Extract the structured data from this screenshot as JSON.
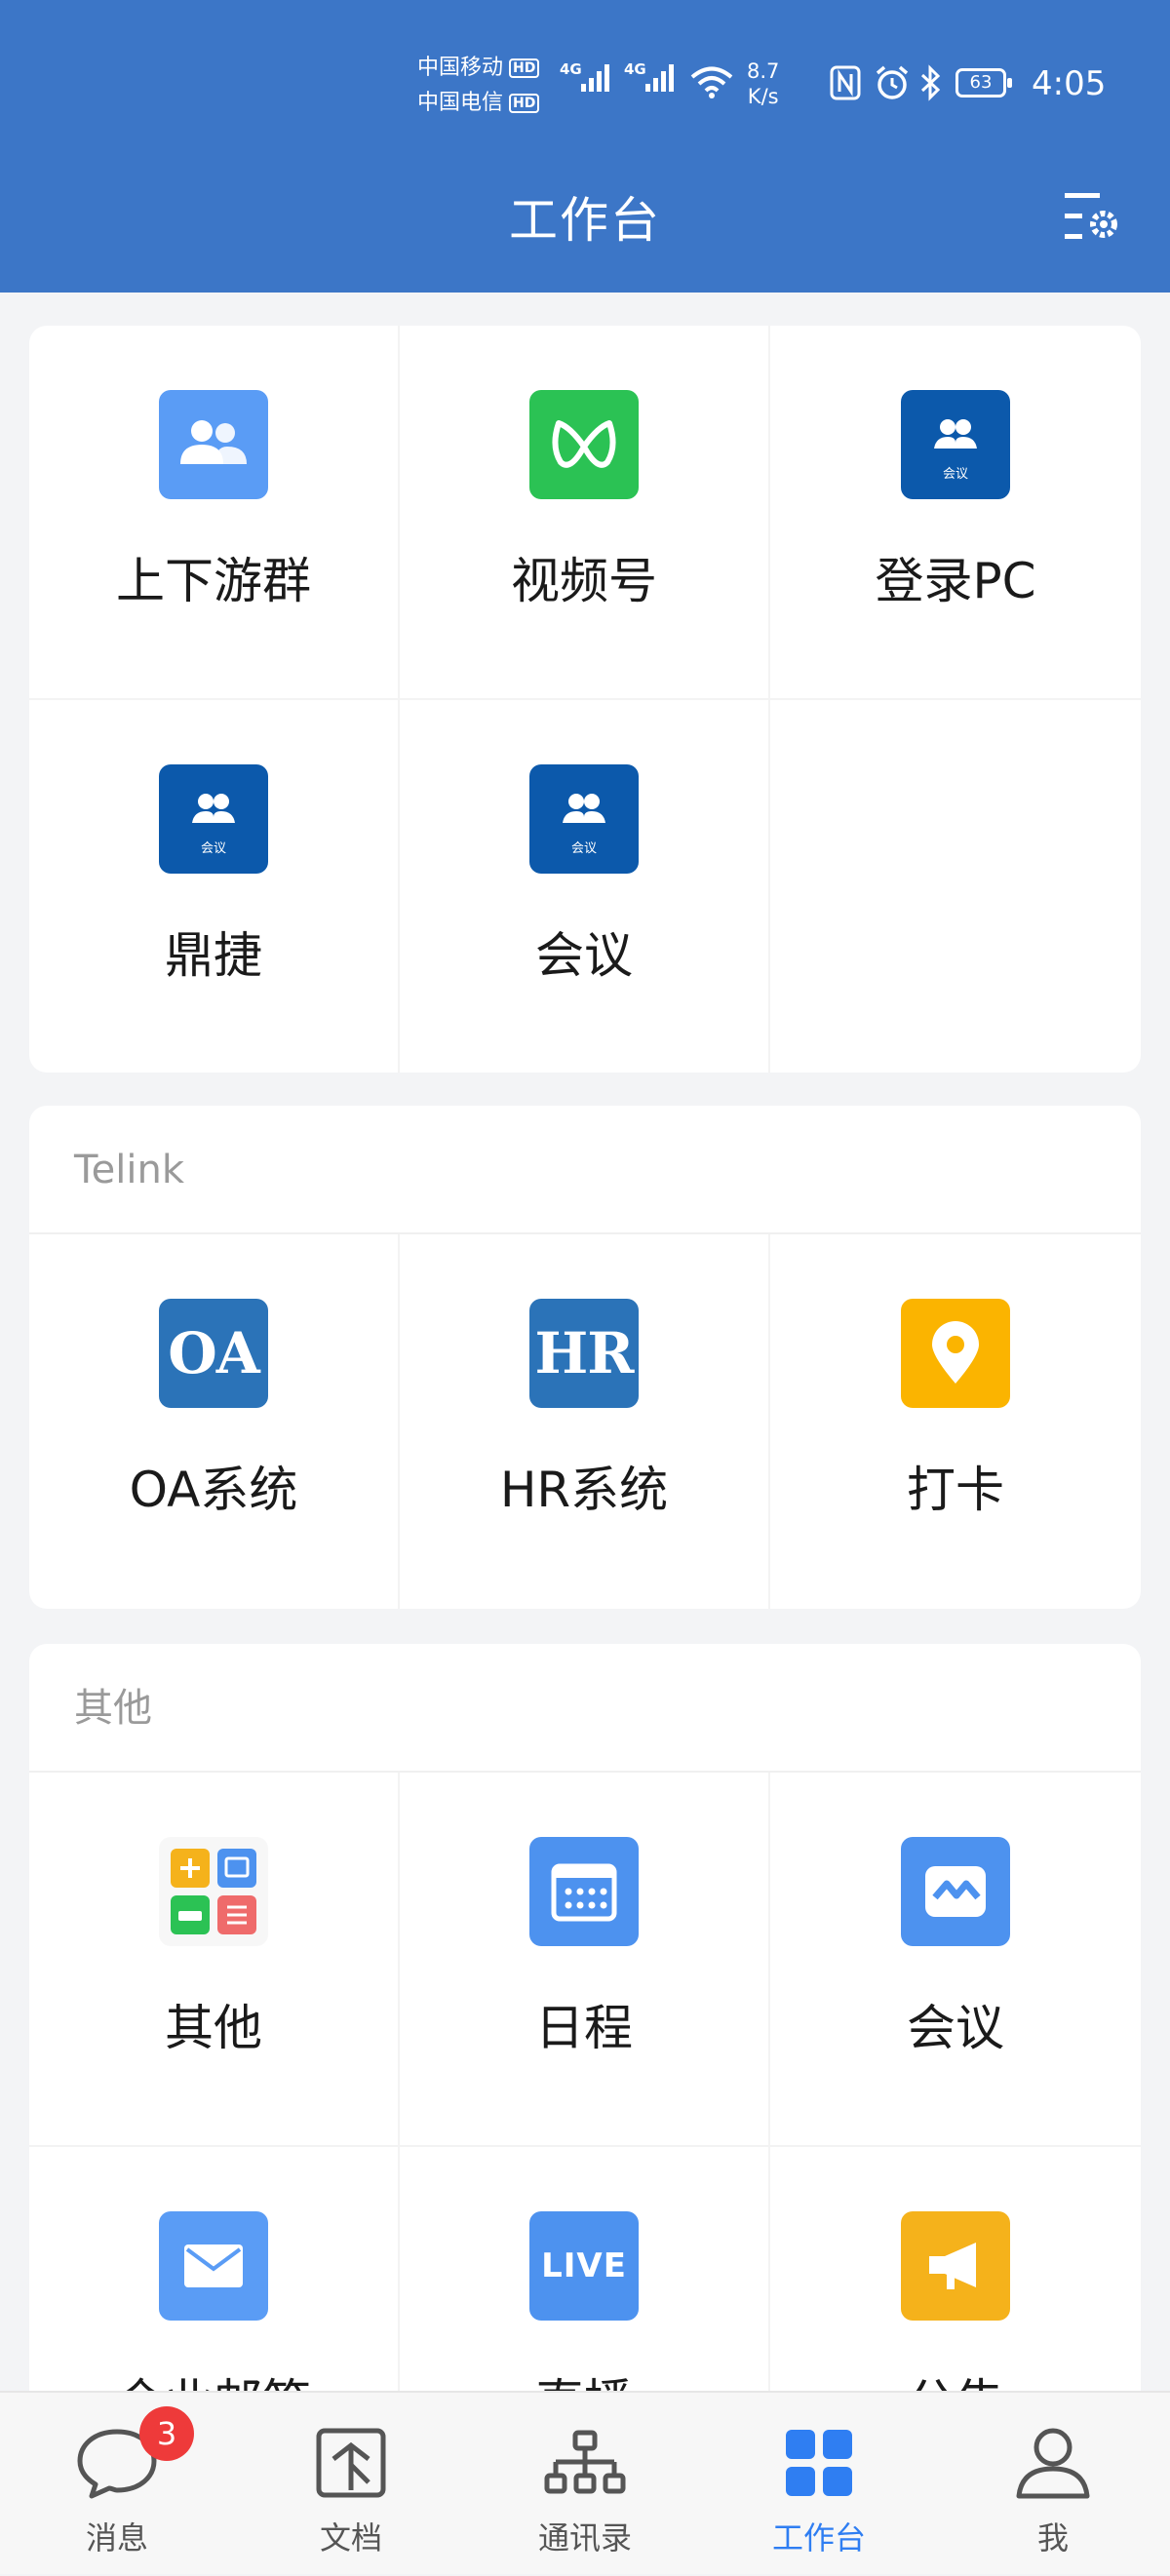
{
  "status_bar": {
    "carrier1": "中国移动",
    "carrier2": "中国电信",
    "hd": "HD",
    "net1": "4G",
    "net2": "4G",
    "speed_value": "8.7",
    "speed_unit": "K/s",
    "battery": "63",
    "time": "4:05",
    "icons": [
      "nfc-icon",
      "alarm-icon",
      "bluetooth-icon",
      "wifi-icon"
    ]
  },
  "header": {
    "title": "工作台",
    "settings_icon": "list-settings-icon"
  },
  "colors": {
    "header_bg": "#3c76c7",
    "accent": "#2f7ef2",
    "badge": "#ee3a3a"
  },
  "section1": {
    "apps": [
      {
        "label": "上下游群",
        "icon": "group-people-icon",
        "color": "#5a9cf5"
      },
      {
        "label": "视频号",
        "icon": "video-channel-icon",
        "color": "#2bc254"
      },
      {
        "label": "登录PC",
        "icon": "meeting-icon",
        "color": "#0c59ab",
        "sub": "会议"
      },
      {
        "label": "鼎捷",
        "icon": "meeting-icon",
        "color": "#0c59ab",
        "sub": "会议"
      },
      {
        "label": "会议",
        "icon": "meeting-icon",
        "color": "#0c59ab",
        "sub": "会议"
      }
    ]
  },
  "section2": {
    "title": "Telink",
    "apps": [
      {
        "label": "OA系统",
        "icon_text": "OA",
        "color": "#2b73b8"
      },
      {
        "label": "HR系统",
        "icon_text": "HR",
        "color": "#2b73b8"
      },
      {
        "label": "打卡",
        "icon": "location-pin-icon",
        "color": "#fbb400"
      }
    ]
  },
  "section3": {
    "title": "其他",
    "apps": [
      {
        "label": "其他",
        "icon": "app-grid-icon"
      },
      {
        "label": "日程",
        "icon": "calendar-icon",
        "color": "#4d92ef"
      },
      {
        "label": "会议",
        "icon": "meeting-room-icon",
        "color": "#4d92ef"
      },
      {
        "label": "企业邮箱",
        "icon": "mail-icon",
        "color": "#5a9cf5"
      },
      {
        "label": "直播",
        "icon_text": "LIVE",
        "color": "#4d92ef"
      },
      {
        "label": "公告",
        "icon": "megaphone-icon",
        "color": "#f5b21b"
      }
    ]
  },
  "tabbar": {
    "tabs": [
      {
        "label": "消息",
        "icon": "chat-bubble-icon",
        "badge": "3"
      },
      {
        "label": "文档",
        "icon": "document-icon"
      },
      {
        "label": "通讯录",
        "icon": "org-chart-icon"
      },
      {
        "label": "工作台",
        "icon": "workbench-grid-icon",
        "active": true
      },
      {
        "label": "我",
        "icon": "person-icon"
      }
    ]
  }
}
